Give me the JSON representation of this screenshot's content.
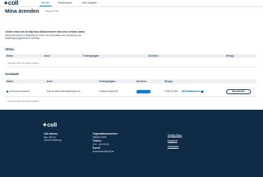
{
  "brand": {
    "logo_text": "coll",
    "logo_mark": "✦"
  },
  "nav": {
    "items": [
      "Ärenden",
      "Meddelanden",
      "Mina uppgifter"
    ],
    "active_index": 0,
    "right_items": [
      "",
      ""
    ]
  },
  "page": {
    "title": "Mina ärenden",
    "printed_label": "Printad: 9:46"
  },
  "intro": {
    "line1": "I listan nedan kan du följa dina aktiva ärenden samt dess senaste status.",
    "line2": "Klicka på Ärende & betalning för att se mer information om ditt ärende och",
    "line3": "betalningsuppgifterna för ärendet."
  },
  "active": {
    "title": "Aktiva",
    "columns": [
      "Status",
      "Avser",
      "Fordringsägare",
      "Ärendenr.",
      "Belopp"
    ],
    "empty_note": "* Aktuella skätt och betalningsflöde"
  },
  "closed": {
    "title": "Avslutade",
    "columns": [
      "Status",
      "Avser",
      "Fordringsägare",
      "Ärendenr.",
      "Belopp"
    ],
    "rows": [
      {
        "status": "Ärendet är avslutat",
        "avser": "Köp via www.hemmashoppen.se",
        "creditor": "Collector Bank AB",
        "amount": "2 305,50 SEK",
        "messages": "(6) Meddelanden",
        "action": "Visa ärende"
      }
    ],
    "note": "* Aktuella skätt och betalningsflöde"
  },
  "footer": {
    "logo_text": "coll",
    "company": "Coll Inkasso",
    "address1": "Box 795 14",
    "address2": "404 36 Göteborg",
    "org_label": "Organisationsnummer:",
    "org_number": "556523-0363",
    "phone_label": "Telefon:",
    "phone": "010 - 163 93 00",
    "email_label": "E-post:",
    "email": "kundservice@coll.se",
    "links": [
      "Vanliga frågor",
      "Klagomål",
      "Dataskydd"
    ]
  },
  "colors": {
    "primary": "#0f2b45",
    "accent": "#0b6e9e",
    "success": "#1b8a4b"
  }
}
